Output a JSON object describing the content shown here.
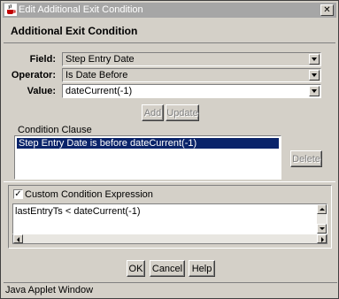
{
  "window": {
    "title": "Edit Additional Exit Condition",
    "close_glyph": "✕"
  },
  "heading": "Additional Exit Condition",
  "form": {
    "field_label": "Field:",
    "field_value": "Step Entry Date",
    "operator_label": "Operator:",
    "operator_value": "Is Date Before",
    "value_label": "Value:",
    "value_value": "dateCurrent(-1)"
  },
  "buttons": {
    "add": "Add",
    "update": "Update",
    "delete": "Delete",
    "ok": "OK",
    "cancel": "Cancel",
    "help": "Help"
  },
  "condition_clause": {
    "label": "Condition Clause",
    "items": [
      "Step Entry Date is before dateCurrent(-1)"
    ]
  },
  "custom": {
    "checkbox_label": "Custom Condition Expression",
    "checked": true,
    "check_glyph": "✓",
    "expression": "lastEntryTs < dateCurrent(-1)"
  },
  "status_bar": "Java Applet Window",
  "colors": {
    "title_bar": "#a6a6a6",
    "selection": "#0a246a",
    "window_bg": "#d4d0c8"
  }
}
